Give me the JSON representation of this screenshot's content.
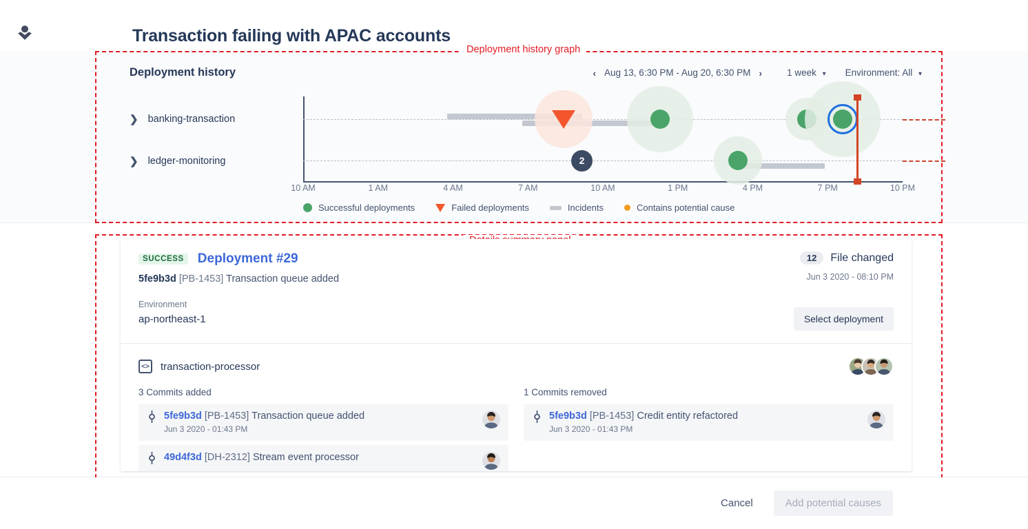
{
  "rail": {
    "avatar_icon": "person-icon",
    "close_icon": "close-icon"
  },
  "page_title": "Transaction failing with APAC accounts",
  "annotations": {
    "graph_label": "Deployment history graph",
    "details_label": "Details summary panel",
    "color": "#e01b24"
  },
  "graph": {
    "title": "Deployment history",
    "prev_icon": "chevron-left-icon",
    "next_icon": "chevron-right-icon",
    "date_range": "Aug 13, 6:30 PM - Aug 20, 6:30 PM",
    "interval": "1 week",
    "environment": "Environment: All",
    "caret": "⌄",
    "services": [
      {
        "name": "banking-transaction",
        "chevron": "›"
      },
      {
        "name": "ledger-monitoring",
        "chevron": "›"
      }
    ],
    "incident_badge": "2",
    "legend": [
      {
        "marker": "dot",
        "label": "Successful deployments",
        "color": "#4aa46a"
      },
      {
        "marker": "tri",
        "label": "Failed deployments",
        "color": "#f3552c"
      },
      {
        "marker": "bar",
        "label": "Incidents",
        "color": "#c2c7d0"
      },
      {
        "marker": "sm",
        "label": "Contains potential cause",
        "color": "#f29c1f"
      }
    ]
  },
  "chart_data": {
    "type": "scatter",
    "title": "Deployment history",
    "xlabel": "",
    "ylabel": "",
    "x_ticks": [
      "10 AM",
      "1 AM",
      "4 AM",
      "7 AM",
      "10 AM",
      "1 PM",
      "4 PM",
      "7 PM",
      "10 PM"
    ],
    "x_tick_pct": [
      0,
      12.5,
      25,
      37.5,
      50,
      62.5,
      75,
      87.5,
      100
    ],
    "lanes": [
      "banking-transaction",
      "ledger-monitoring"
    ],
    "grid": "dashed-horizontal",
    "legend_position": "bottom",
    "points": [
      {
        "lane": 1,
        "x_pct": 43.5,
        "type": "failed",
        "halo": 84,
        "label": "Failed deployment"
      },
      {
        "lane": 1,
        "x_pct": 59.5,
        "type": "successful",
        "halo": 96,
        "label": "Successful deployment"
      },
      {
        "lane": 1,
        "x_pct": 84.0,
        "type": "successful",
        "halo": 62,
        "label": "Successful deployment"
      },
      {
        "lane": 1,
        "x_pct": 90.0,
        "type": "successful",
        "halo": 110,
        "selected": true,
        "label": "Deployment #29"
      },
      {
        "lane": 2,
        "x_pct": 72.5,
        "type": "successful",
        "halo": 70,
        "label": "Successful deployment"
      }
    ],
    "incidents": [
      {
        "lane": 1,
        "start_pct": 24.0,
        "end_pct": 46.5
      },
      {
        "lane": 1,
        "start_pct": 36.5,
        "end_pct": 59.0
      },
      {
        "lane": 2,
        "start_pct": 72.0,
        "end_pct": 87.0
      }
    ],
    "marker_line": {
      "x_pct": 92.5,
      "color": "#d24527"
    },
    "incident_count_badge": {
      "lane": 2,
      "x_pct": 46.5,
      "value": "2"
    }
  },
  "details": {
    "status": "SUCCESS",
    "deployment_title": "Deployment #29",
    "commit_hash": "5fe9b3d",
    "commit_ticket": "[PB-1453]",
    "commit_message": "Transaction queue added",
    "environment_label": "Environment",
    "environment_value": "ap-northeast-1",
    "file_count": "12",
    "file_changed_label": "File changed",
    "deployment_date": "Jun 3 2020 - 08:10 PM",
    "select_button": "Select deployment",
    "repo_name": "transaction-processor",
    "repo_icon": "code-icon",
    "commits_added_title": "3 Commits added",
    "commits_removed_title": "1 Commits removed",
    "commits_added": [
      {
        "hash": "5fe9b3d",
        "ticket": "[PB-1453]",
        "message": "Transaction queue added",
        "time": "Jun 3 2020 - 01:43 PM"
      },
      {
        "hash": "49d4f3d",
        "ticket": "[DH-2312]",
        "message": "Stream event processor",
        "time": ""
      }
    ],
    "commits_removed": [
      {
        "hash": "5fe9b3d",
        "ticket": "[PB-1453]",
        "message": "Credit entity refactored",
        "time": "Jun 3 2020 - 01:43 PM"
      }
    ]
  },
  "footer": {
    "cancel": "Cancel",
    "add_potential_causes": "Add potential causes"
  }
}
